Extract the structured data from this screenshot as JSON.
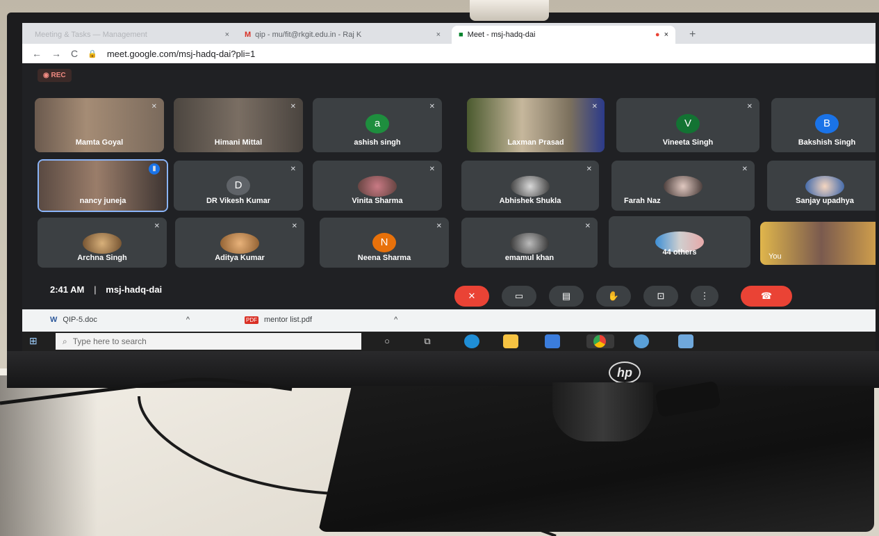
{
  "browser": {
    "tabs": [
      {
        "label": "Meeting & Tasks — Management",
        "close": "×"
      },
      {
        "label": "qip - mu/fit@rkgit.edu.in - Raj K",
        "close": "×"
      },
      {
        "label": "Meet - msj-hadq-dai",
        "close": "×"
      }
    ],
    "url": "meet.google.com/msj-hadq-dai?pli=1"
  },
  "meet": {
    "rec_badge": "◉ REC",
    "participants_row1": [
      {
        "name": "Mamta Goyal"
      },
      {
        "name": "Himani Mittal"
      },
      {
        "name": "ashish singh",
        "initial": "a",
        "color": "#1e8e3e"
      },
      {
        "name": "Laxman Prasad"
      },
      {
        "name": "Vineeta Singh",
        "initial": "V",
        "color": "#137333"
      },
      {
        "name": "Bakshish Singh",
        "initial": "B",
        "color": "#1a73e8"
      }
    ],
    "participants_row2": [
      {
        "name": "nancy juneja"
      },
      {
        "name": "DR Vikesh Kumar",
        "initial": "D",
        "color": "#5f6368"
      },
      {
        "name": "Vinita Sharma"
      },
      {
        "name": "Abhishek Shukla"
      },
      {
        "name": "Farah Naz"
      },
      {
        "name": "Sanjay upadhya"
      }
    ],
    "participants_row3": [
      {
        "name": "Archna Singh"
      },
      {
        "name": "Aditya Kumar"
      },
      {
        "name": "Neena Sharma",
        "initial": "N",
        "color": "#e8710a"
      },
      {
        "name": "emamul khan"
      },
      {
        "name": "44 others"
      },
      {
        "name": "You"
      }
    ],
    "time": "2:41 AM",
    "meeting_code": "msj-hadq-dai",
    "separator": "|"
  },
  "downloads": [
    {
      "label": "QIP-5.doc"
    },
    {
      "label": "mentor list.pdf"
    }
  ],
  "taskbar": {
    "search_placeholder": "Type here to search"
  },
  "brand": {
    "logo": "hp"
  }
}
